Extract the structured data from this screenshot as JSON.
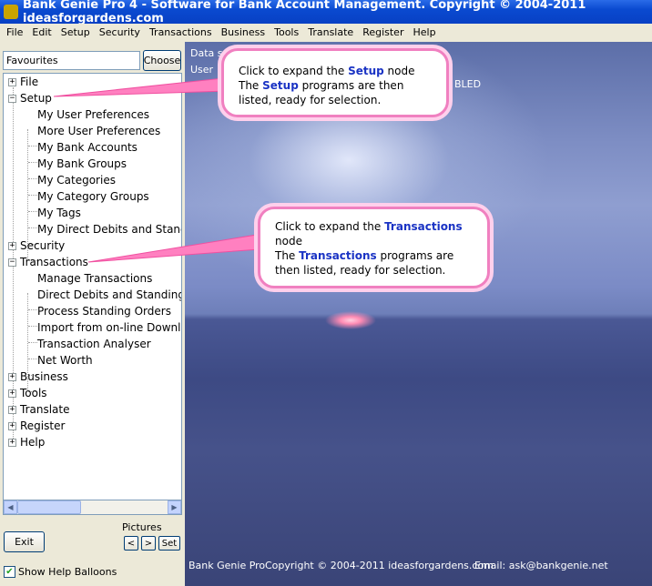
{
  "window": {
    "title": "Bank Genie Pro 4 - Software for Bank Account Management. Copyright © 2004-2011 ideasforgardens.com"
  },
  "menu": [
    "File",
    "Edit",
    "Setup",
    "Security",
    "Transactions",
    "Business",
    "Tools",
    "Translate",
    "Register",
    "Help"
  ],
  "favourites": {
    "value": "Favourites",
    "choose_label": "Choose"
  },
  "tree": {
    "file": "File",
    "setup": "Setup",
    "setup_children": [
      "My User Preferences",
      "More User Preferences",
      "My Bank Accounts",
      "My Bank Groups",
      "My Categories",
      "My Category Groups",
      "My Tags",
      "My Direct Debits and Standin"
    ],
    "security": "Security",
    "transactions": "Transactions",
    "transactions_children": [
      "Manage Transactions",
      "Direct Debits and Standing C",
      "Process Standing Orders",
      "Import from on-line Downloa",
      "Transaction Analyser",
      "Net Worth"
    ],
    "business": "Business",
    "tools": "Tools",
    "translate": "Translate",
    "register": "Register",
    "help": "Help"
  },
  "controls": {
    "exit": "Exit",
    "pictures": "Pictures",
    "prev": "<",
    "next": ">",
    "set": "Set",
    "show_balloons": "Show Help Balloons",
    "show_balloons_checked": "✔"
  },
  "photo": {
    "data_label": "Data s",
    "user_label": "User",
    "bled_text": "BLED",
    "footer_app": "Bank Genie Pro",
    "footer_copyright": "Copyright © 2004-2011 ideasforgardens.com",
    "footer_email": "Email:  ask@bankgenie.net"
  },
  "balloon_setup": {
    "line1_pre": "Click to expand the ",
    "keyword": "Setup",
    "line1_post": " node",
    "line2_pre": "The ",
    "line2_keyword": "Setup",
    "line2_post": " programs are then",
    "line3": "listed, ready for selection."
  },
  "balloon_transactions": {
    "line1_pre": "Click to expand the ",
    "keyword": "Transactions",
    "line2": "node",
    "line3_pre": "The ",
    "line3_keyword": "Transactions",
    "line3_post": " programs are",
    "line4": "then listed, ready for selection."
  }
}
